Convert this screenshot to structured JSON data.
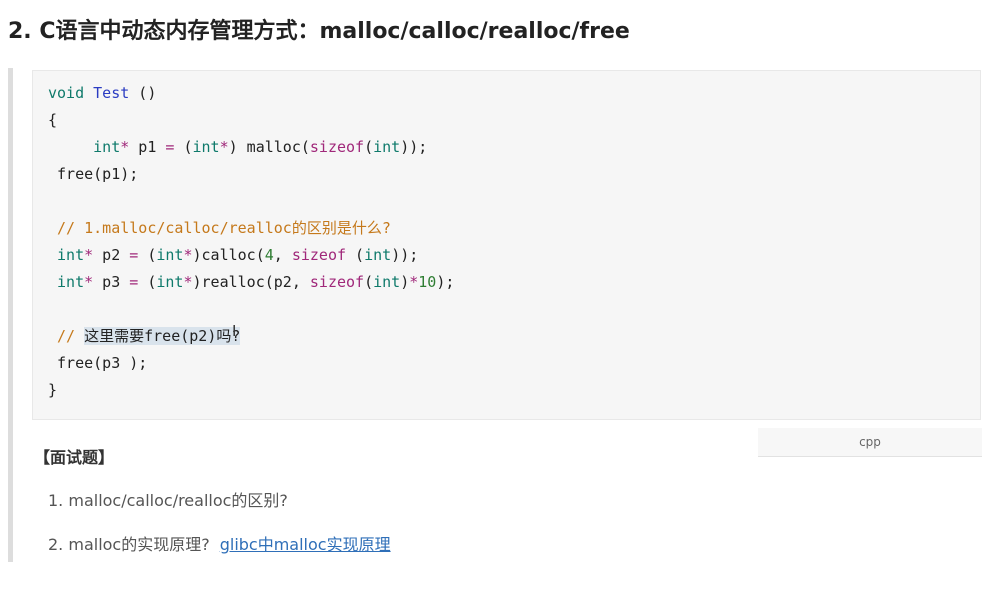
{
  "section_heading": "2. C语言中动态内存管理方式：malloc/calloc/realloc/free",
  "code": {
    "language_label": "cpp",
    "lines": [
      [
        {
          "t": "void",
          "c": "kw"
        },
        {
          "t": " "
        },
        {
          "t": "Test",
          "c": "fn"
        },
        {
          "t": " ()"
        }
      ],
      [
        {
          "t": "{"
        }
      ],
      [
        {
          "t": "     "
        },
        {
          "t": "int",
          "c": "kw"
        },
        {
          "t": "*",
          "c": "op"
        },
        {
          "t": " p1 "
        },
        {
          "t": "=",
          "c": "op"
        },
        {
          "t": " ("
        },
        {
          "t": "int",
          "c": "kw"
        },
        {
          "t": "*",
          "c": "op"
        },
        {
          "t": ") malloc("
        },
        {
          "t": "sizeof",
          "c": "op"
        },
        {
          "t": "("
        },
        {
          "t": "int",
          "c": "kw"
        },
        {
          "t": "));"
        }
      ],
      [
        {
          "t": " free(p1);"
        }
      ],
      [
        {
          "t": ""
        }
      ],
      [
        {
          "t": " // 1.malloc/calloc/realloc的区别是什么?",
          "c": "cmt"
        }
      ],
      [
        {
          "t": " "
        },
        {
          "t": "int",
          "c": "kw"
        },
        {
          "t": "*",
          "c": "op"
        },
        {
          "t": " p2 "
        },
        {
          "t": "=",
          "c": "op"
        },
        {
          "t": " ("
        },
        {
          "t": "int",
          "c": "kw"
        },
        {
          "t": "*",
          "c": "op"
        },
        {
          "t": ")calloc("
        },
        {
          "t": "4",
          "c": "num"
        },
        {
          "t": ", "
        },
        {
          "t": "sizeof",
          "c": "op"
        },
        {
          "t": " ("
        },
        {
          "t": "int",
          "c": "kw"
        },
        {
          "t": "));"
        }
      ],
      [
        {
          "t": " "
        },
        {
          "t": "int",
          "c": "kw"
        },
        {
          "t": "*",
          "c": "op"
        },
        {
          "t": " p3 "
        },
        {
          "t": "=",
          "c": "op"
        },
        {
          "t": " ("
        },
        {
          "t": "int",
          "c": "kw"
        },
        {
          "t": "*",
          "c": "op"
        },
        {
          "t": ")realloc(p2, "
        },
        {
          "t": "sizeof",
          "c": "op"
        },
        {
          "t": "("
        },
        {
          "t": "int",
          "c": "kw"
        },
        {
          "t": ")"
        },
        {
          "t": "*",
          "c": "op"
        },
        {
          "t": "10",
          "c": "num"
        },
        {
          "t": ");"
        }
      ],
      [
        {
          "t": ""
        }
      ],
      [
        {
          "t": " // ",
          "c": "cmt"
        },
        {
          "t": "这里需要free(p2)吗?",
          "c": "sel"
        }
      ],
      [
        {
          "t": " free(p3 );"
        }
      ],
      [
        {
          "t": "}"
        }
      ]
    ]
  },
  "interview": {
    "title": "【面试题】",
    "items": [
      {
        "text": "1. malloc/calloc/realloc的区别?",
        "link": ""
      },
      {
        "text": "2. malloc的实现原理?",
        "link": "glibc中malloc实现原理"
      }
    ]
  },
  "colors": {
    "keyword": "#0f7a6b",
    "function": "#2b3cc2",
    "operator": "#a0287a",
    "number": "#2e7d32",
    "comment": "#c5791b",
    "link": "#2f6fb8",
    "code_bg": "#f6f6f6"
  }
}
